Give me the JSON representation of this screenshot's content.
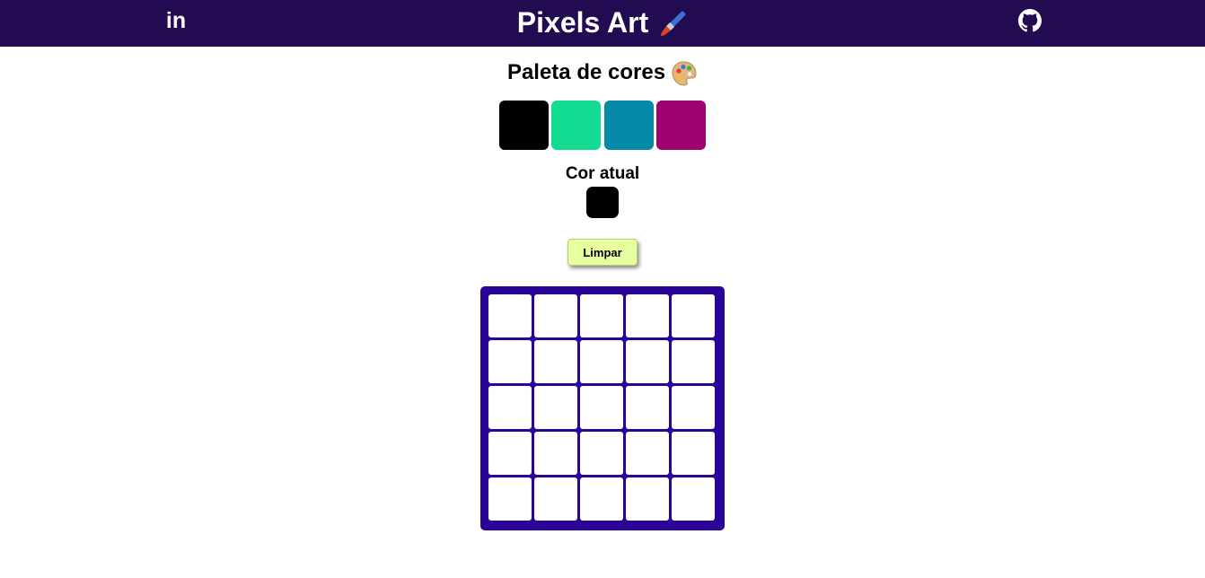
{
  "header": {
    "title": "Pixels Art",
    "linkedin_text": "in",
    "icons": [
      "linkedin-icon",
      "paint-brush-icon",
      "github-icon"
    ],
    "background": "#220b51"
  },
  "palette": {
    "title": "Paleta de cores",
    "icon": "artist-palette-icon",
    "colors": [
      "#000000",
      "#13db91",
      "#0489a6",
      "#9e0170"
    ]
  },
  "current": {
    "label": "Cor atual",
    "color": "#000000"
  },
  "clear_button": {
    "label": "Limpar",
    "background": "#e7ff9f"
  },
  "board": {
    "rows": 5,
    "cols": 5,
    "background": "#2a0496",
    "cell_color": "#ffffff"
  }
}
